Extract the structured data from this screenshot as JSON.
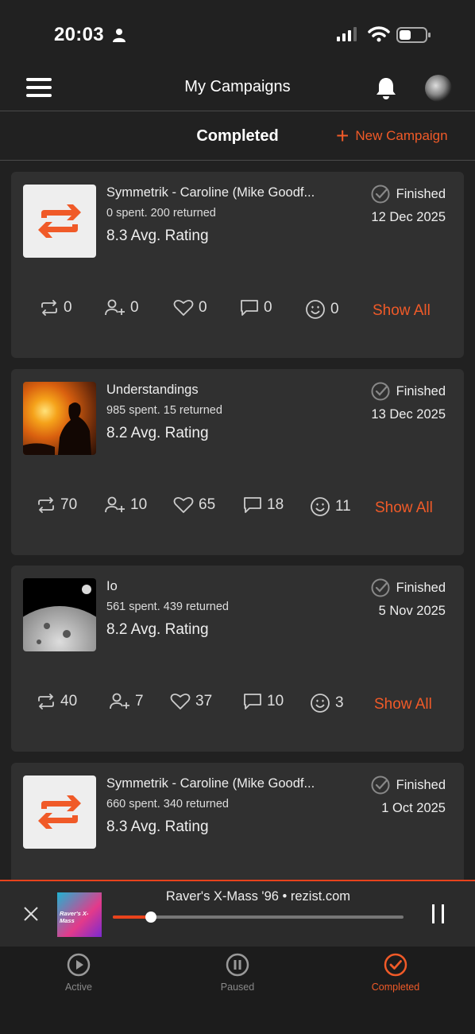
{
  "status_bar": {
    "time": "20:03"
  },
  "header": {
    "title": "My Campaigns"
  },
  "sub_header": {
    "title": "Completed",
    "new_campaign": "New Campaign"
  },
  "colors": {
    "accent": "#f05a28",
    "background": "#212121",
    "card": "#303030"
  },
  "campaigns": [
    {
      "title": "Symmetrik - Caroline (Mike Goodf...",
      "spent": "0 spent. 200 returned",
      "rating": "8.3 Avg. Rating",
      "status": "Finished",
      "date": "12 Dec 2025",
      "thumb": "repost-logo",
      "stats": {
        "reposts": "0",
        "follows": "0",
        "likes": "0",
        "comments": "0",
        "reactions": "0"
      },
      "show_all": "Show All"
    },
    {
      "title": "Understandings",
      "spent": "985 spent. 15 returned",
      "rating": "8.2 Avg. Rating",
      "status": "Finished",
      "date": "13 Dec 2025",
      "thumb": "sunset-photo",
      "stats": {
        "reposts": "70",
        "follows": "10",
        "likes": "65",
        "comments": "18",
        "reactions": "11"
      },
      "show_all": "Show All"
    },
    {
      "title": "Io",
      "spent": "561 spent. 439 returned",
      "rating": "8.2 Avg. Rating",
      "status": "Finished",
      "date": "5 Nov 2025",
      "thumb": "moon-photo",
      "stats": {
        "reposts": "40",
        "follows": "7",
        "likes": "37",
        "comments": "10",
        "reactions": "3"
      },
      "show_all": "Show All"
    },
    {
      "title": "Symmetrik - Caroline (Mike Goodf...",
      "spent": "660 spent. 340 returned",
      "rating": "8.3 Avg. Rating",
      "status": "Finished",
      "date": "1 Oct 2025",
      "thumb": "repost-logo"
    }
  ],
  "player": {
    "track": "Raver's X-Mass '96 • rezist.com",
    "art_text": "Raver's X-Mass",
    "progress": 0.13
  },
  "tabs": [
    {
      "label": "Active",
      "icon": "play-circle-icon"
    },
    {
      "label": "Paused",
      "icon": "pause-circle-icon"
    },
    {
      "label": "Completed",
      "icon": "check-circle-icon",
      "active": true
    }
  ]
}
